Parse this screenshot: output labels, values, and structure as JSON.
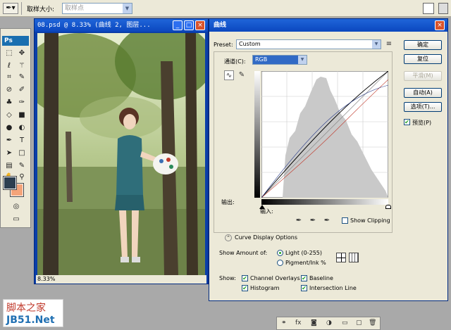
{
  "optbar": {
    "sample_label": "取样大小:",
    "sample_value": "取样点"
  },
  "toolbox": {
    "logo": "Ps"
  },
  "document": {
    "title": "08.psd @ 8.33% (曲线 2, 图层...",
    "min_btn": "_",
    "max_btn": "□",
    "close_btn": "×",
    "zoom": "8.33%"
  },
  "curves": {
    "title": "曲线",
    "preset_label": "Preset:",
    "preset_value": "Custom",
    "channel_label": "通道(C):",
    "channel_value": "RGB",
    "output_label": "输出:",
    "input_label": "输入:",
    "show_clipping_label": "Show Clipping",
    "curve_display_label": "Curve Display Options",
    "show_amount_label": "Show Amount of:",
    "light_label": "Light  (0-255)",
    "pigment_label": "Pigment/Ink %",
    "show_label": "Show:",
    "channel_overlays": "Channel Overlays",
    "baseline": "Baseline",
    "histogram": "Histogram",
    "intersection_line": "Intersection Line",
    "buttons": {
      "ok": "确定",
      "reset": "复位",
      "smooth": "平滑(M)",
      "auto": "自动(A)",
      "options": "选项(T)...",
      "preview": "预览(P)"
    }
  },
  "watermark": {
    "line1": "脚本之家",
    "line2": "JB51.Net"
  },
  "colors": {
    "titlebar": "#0b47bf",
    "foreground": "#2c3e50",
    "background": "#f4a47a"
  },
  "icons": [
    "move-icon",
    "marquee-icon",
    "lasso-icon",
    "wand-icon",
    "crop-icon",
    "eyedropper-icon",
    "heal-icon",
    "brush-icon",
    "stamp-icon",
    "history-brush-icon",
    "eraser-icon",
    "gradient-icon",
    "blur-icon",
    "dodge-icon",
    "pen-icon",
    "type-icon",
    "path-select-icon",
    "shape-icon",
    "notes-icon",
    "eyedropper2-icon",
    "hand-icon",
    "zoom-icon"
  ]
}
